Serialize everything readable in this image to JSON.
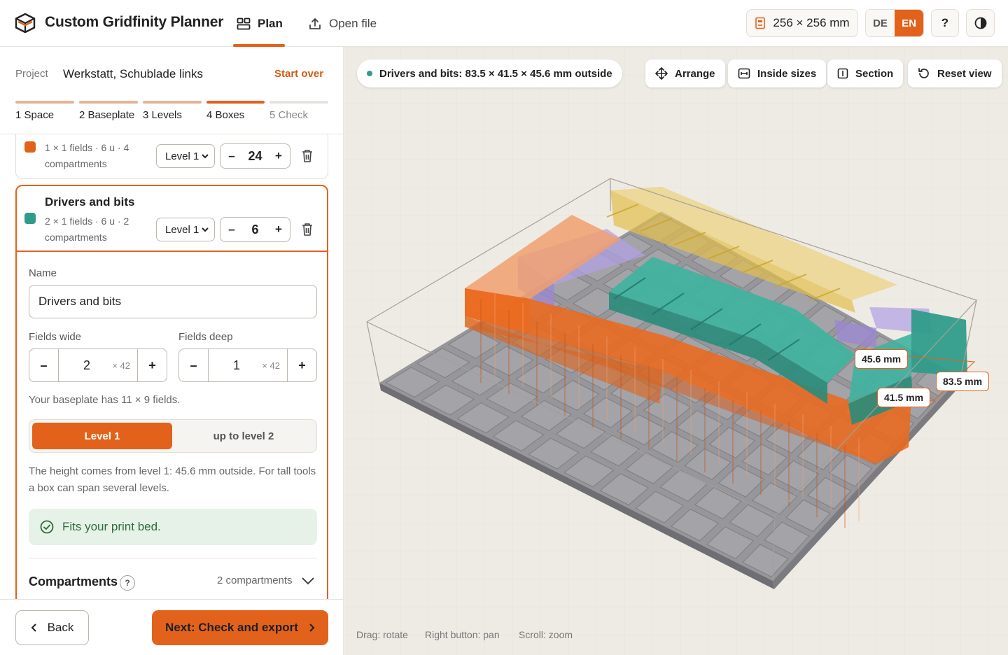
{
  "header": {
    "title": "Custom Gridfinity Planner",
    "tabs": [
      {
        "label": "Plan"
      },
      {
        "label": "Open file"
      }
    ],
    "bed_size": "256 × 256 mm",
    "lang": [
      {
        "label": "DE"
      },
      {
        "label": "EN"
      }
    ],
    "help": "?"
  },
  "project": {
    "label": "Project",
    "name": "Werkstatt, Schublade links",
    "start_over": "Start over"
  },
  "steps": [
    {
      "label": "1  Space"
    },
    {
      "label": "2  Baseplate"
    },
    {
      "label": "3  Levels"
    },
    {
      "label": "4  Boxes"
    },
    {
      "label": "5  Check"
    }
  ],
  "boxes": [
    {
      "meta": "1 × 1 fields · 6 u · 4 compartments",
      "level": "Level 1",
      "count": "24",
      "color": "#e2621b"
    },
    {
      "title": "Drivers and bits",
      "meta": "2 × 1 fields · 6 u · 2 compartments",
      "level": "Level 1",
      "count": "6",
      "color": "#2f9c8a"
    }
  ],
  "editor": {
    "name_label": "Name",
    "name_value": "Drivers and bits",
    "wide_label": "Fields wide",
    "wide_value": "2",
    "deep_label": "Fields deep",
    "deep_value": "1",
    "unit": "× 42",
    "baseplate_hint": "Your baseplate has 11 × 9 fields.",
    "level_options": [
      {
        "label": "Level 1"
      },
      {
        "label": "up to level 2"
      }
    ],
    "height_hint": "The height comes from level 1: 45.6 mm outside. For tall tools a box can span several levels.",
    "fits": "Fits your print bed.",
    "compartments_title": "Compartments",
    "compartments_help": "?",
    "compartments_count": "2 compartments"
  },
  "footer": {
    "back": "Back",
    "next": "Next: Check and export"
  },
  "viewport": {
    "selection_info": "Drivers and bits: 83.5 × 41.5 × 45.6 mm outside",
    "tools": [
      {
        "label": "Arrange"
      },
      {
        "label": "Inside sizes"
      },
      {
        "label": "Section"
      },
      {
        "label": "Reset view"
      }
    ],
    "dims": {
      "height": "45.6 mm",
      "width": "83.5 mm",
      "depth": "41.5 mm"
    },
    "hints": [
      "Drag: rotate",
      "Right button: pan",
      "Scroll: zoom"
    ]
  },
  "colors": {
    "accent": "#e2621b",
    "teal": "#2f9c8a",
    "violet": "#9b86d6",
    "yellow": "#e9c85a",
    "baseplate": "#8f8f93"
  }
}
